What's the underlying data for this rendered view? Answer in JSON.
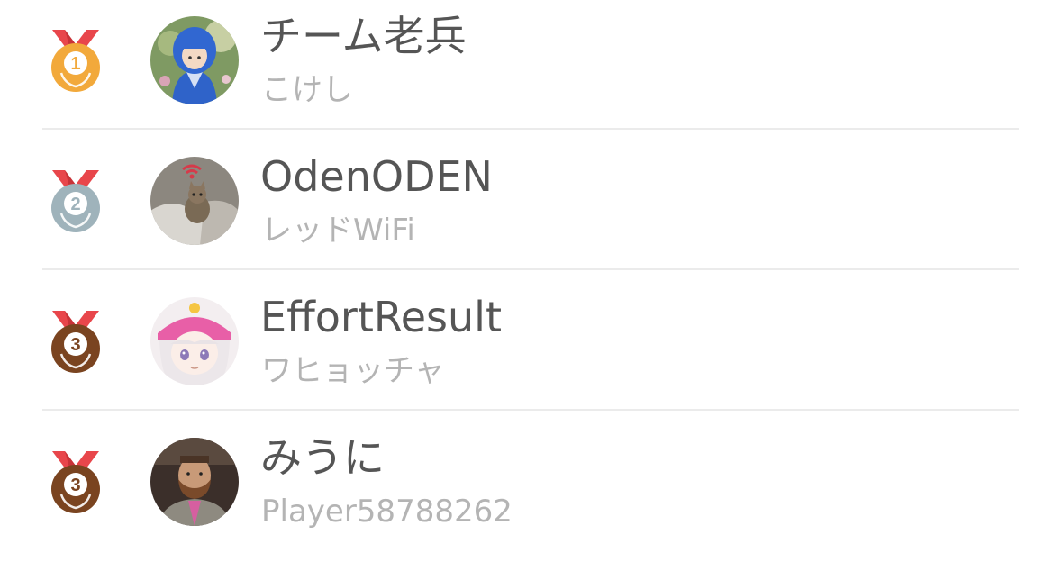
{
  "ranking": {
    "entries": [
      {
        "rank": "1",
        "medal": "gold-medal-icon",
        "medal_color": "#f2a93b",
        "name": "チーム老兵",
        "subtitle": "こけし",
        "avatar": "kokeshi-doll-avatar"
      },
      {
        "rank": "2",
        "medal": "silver-medal-icon",
        "medal_color": "#9fb3bb",
        "name": "OdenODEN",
        "subtitle": "レッドWiFi",
        "avatar": "cat-photo-avatar"
      },
      {
        "rank": "3",
        "medal": "bronze-medal-icon",
        "medal_color": "#7a4420",
        "name": "EffortResult",
        "subtitle": "ワヒョッチャ",
        "avatar": "anime-girl-avatar"
      },
      {
        "rank": "3",
        "medal": "bronze-medal-icon",
        "medal_color": "#7a4420",
        "name": "みうに",
        "subtitle": "Player58788262",
        "avatar": "bearded-man-photo-avatar"
      }
    ]
  },
  "colors": {
    "ribbon": "#e8464b",
    "name_text": "#555555",
    "subtitle_text": "#b4b4b4",
    "divider": "#ebebeb"
  }
}
